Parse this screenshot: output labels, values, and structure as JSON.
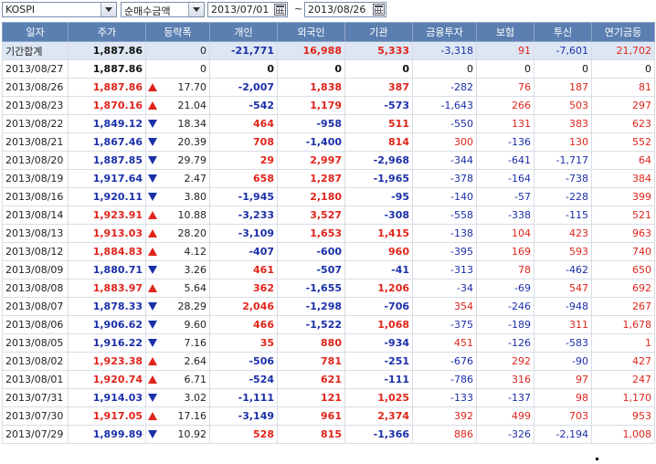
{
  "toolbar": {
    "market": "KOSPI",
    "metric": "순매수금액",
    "start_date": "2013/07/01",
    "separator": "~",
    "end_date": "2013/08/26"
  },
  "columns": [
    "일자",
    "주가",
    "등락폭",
    "개인",
    "외국인",
    "기관",
    "금융투자",
    "보험",
    "투신",
    "연기금등"
  ],
  "summary": {
    "date": "기간합계",
    "price": "1,887.86",
    "change": "0",
    "individual": "-21,771",
    "foreign": "16,988",
    "institution": "5,333",
    "fin_invest": "-3,318",
    "insurance": "91",
    "trust": "-7,601",
    "pension": "21,702"
  },
  "rows": [
    {
      "date": "2013/08/27",
      "price": "1,887.86",
      "dir": "none",
      "change": "0",
      "individual": "0",
      "foreign": "0",
      "institution": "0",
      "fin_invest": "0",
      "insurance": "0",
      "trust": "0",
      "pension": "0"
    },
    {
      "date": "2013/08/26",
      "price": "1,887.86",
      "dir": "up",
      "change": "17.70",
      "individual": "-2,007",
      "foreign": "1,838",
      "institution": "387",
      "fin_invest": "-282",
      "insurance": "76",
      "trust": "187",
      "pension": "81"
    },
    {
      "date": "2013/08/23",
      "price": "1,870.16",
      "dir": "up",
      "change": "21.04",
      "individual": "-542",
      "foreign": "1,179",
      "institution": "-573",
      "fin_invest": "-1,643",
      "insurance": "266",
      "trust": "503",
      "pension": "297"
    },
    {
      "date": "2013/08/22",
      "price": "1,849.12",
      "dir": "down",
      "change": "18.34",
      "individual": "464",
      "foreign": "-958",
      "institution": "511",
      "fin_invest": "-550",
      "insurance": "131",
      "trust": "383",
      "pension": "623"
    },
    {
      "date": "2013/08/21",
      "price": "1,867.46",
      "dir": "down",
      "change": "20.39",
      "individual": "708",
      "foreign": "-1,400",
      "institution": "814",
      "fin_invest": "300",
      "insurance": "-136",
      "trust": "130",
      "pension": "552"
    },
    {
      "date": "2013/08/20",
      "price": "1,887.85",
      "dir": "down",
      "change": "29.79",
      "individual": "29",
      "foreign": "2,997",
      "institution": "-2,968",
      "fin_invest": "-344",
      "insurance": "-641",
      "trust": "-1,717",
      "pension": "64"
    },
    {
      "date": "2013/08/19",
      "price": "1,917.64",
      "dir": "down",
      "change": "2.47",
      "individual": "658",
      "foreign": "1,287",
      "institution": "-1,965",
      "fin_invest": "-378",
      "insurance": "-164",
      "trust": "-738",
      "pension": "384"
    },
    {
      "date": "2013/08/16",
      "price": "1,920.11",
      "dir": "down",
      "change": "3.80",
      "individual": "-1,945",
      "foreign": "2,180",
      "institution": "-95",
      "fin_invest": "-140",
      "insurance": "-57",
      "trust": "-228",
      "pension": "399"
    },
    {
      "date": "2013/08/14",
      "price": "1,923.91",
      "dir": "up",
      "change": "10.88",
      "individual": "-3,233",
      "foreign": "3,527",
      "institution": "-308",
      "fin_invest": "-558",
      "insurance": "-338",
      "trust": "-115",
      "pension": "521"
    },
    {
      "date": "2013/08/13",
      "price": "1,913.03",
      "dir": "up",
      "change": "28.20",
      "individual": "-3,109",
      "foreign": "1,653",
      "institution": "1,415",
      "fin_invest": "-138",
      "insurance": "104",
      "trust": "423",
      "pension": "963"
    },
    {
      "date": "2013/08/12",
      "price": "1,884.83",
      "dir": "up",
      "change": "4.12",
      "individual": "-407",
      "foreign": "-600",
      "institution": "960",
      "fin_invest": "-395",
      "insurance": "169",
      "trust": "593",
      "pension": "740"
    },
    {
      "date": "2013/08/09",
      "price": "1,880.71",
      "dir": "down",
      "change": "3.26",
      "individual": "461",
      "foreign": "-507",
      "institution": "-41",
      "fin_invest": "-313",
      "insurance": "78",
      "trust": "-462",
      "pension": "650"
    },
    {
      "date": "2013/08/08",
      "price": "1,883.97",
      "dir": "up",
      "change": "5.64",
      "individual": "362",
      "foreign": "-1,655",
      "institution": "1,206",
      "fin_invest": "-34",
      "insurance": "-69",
      "trust": "547",
      "pension": "692"
    },
    {
      "date": "2013/08/07",
      "price": "1,878.33",
      "dir": "down",
      "change": "28.29",
      "individual": "2,046",
      "foreign": "-1,298",
      "institution": "-706",
      "fin_invest": "354",
      "insurance": "-246",
      "trust": "-948",
      "pension": "267"
    },
    {
      "date": "2013/08/06",
      "price": "1,906.62",
      "dir": "down",
      "change": "9.60",
      "individual": "466",
      "foreign": "-1,522",
      "institution": "1,068",
      "fin_invest": "-375",
      "insurance": "-189",
      "trust": "311",
      "pension": "1,678"
    },
    {
      "date": "2013/08/05",
      "price": "1,916.22",
      "dir": "down",
      "change": "7.16",
      "individual": "35",
      "foreign": "880",
      "institution": "-934",
      "fin_invest": "451",
      "insurance": "-126",
      "trust": "-583",
      "pension": "1"
    },
    {
      "date": "2013/08/02",
      "price": "1,923.38",
      "dir": "up",
      "change": "2.64",
      "individual": "-506",
      "foreign": "781",
      "institution": "-251",
      "fin_invest": "-676",
      "insurance": "292",
      "trust": "-90",
      "pension": "427"
    },
    {
      "date": "2013/08/01",
      "price": "1,920.74",
      "dir": "up",
      "change": "6.71",
      "individual": "-524",
      "foreign": "621",
      "institution": "-111",
      "fin_invest": "-786",
      "insurance": "316",
      "trust": "97",
      "pension": "247"
    },
    {
      "date": "2013/07/31",
      "price": "1,914.03",
      "dir": "down",
      "change": "3.02",
      "individual": "-1,111",
      "foreign": "121",
      "institution": "1,025",
      "fin_invest": "-133",
      "insurance": "-137",
      "trust": "98",
      "pension": "1,170"
    },
    {
      "date": "2013/07/30",
      "price": "1,917.05",
      "dir": "up",
      "change": "17.16",
      "individual": "-3,149",
      "foreign": "961",
      "institution": "2,374",
      "fin_invest": "392",
      "insurance": "499",
      "trust": "703",
      "pension": "953"
    },
    {
      "date": "2013/07/29",
      "price": "1,899.89",
      "dir": "down",
      "change": "10.92",
      "individual": "528",
      "foreign": "815",
      "institution": "-1,366",
      "fin_invest": "886",
      "insurance": "-326",
      "trust": "-2,194",
      "pension": "1,008"
    }
  ],
  "colors": {
    "header_bg": "#5b7fb1",
    "up": "#e0241b",
    "down": "#1b2fa8",
    "summary_bg": "#dde7f3"
  }
}
